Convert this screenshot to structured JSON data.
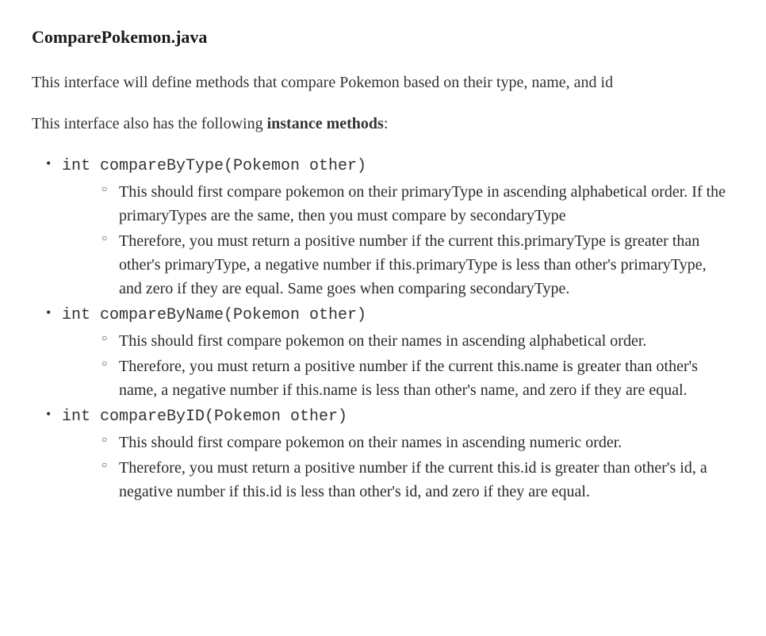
{
  "heading": "ComparePokemon.java",
  "intro": "This interface will define methods that compare Pokemon based on their type, name, and id",
  "secondPara_prefix": "This interface also has the following ",
  "secondPara_bold": "instance methods",
  "secondPara_suffix": ":",
  "methods": [
    {
      "signature": "int compareByType(Pokemon other)",
      "bullets": [
        "This should first compare pokemon on their primaryType in ascending alphabetical order. If the primaryTypes are the same, then you must compare by secondaryType",
        "Therefore, you must return a positive number if the current this.primaryType is greater than other's primaryType, a negative number if this.primaryType is less than other's primaryType, and zero if they are equal. Same goes when comparing secondaryType."
      ]
    },
    {
      "signature": "int compareByName(Pokemon other)",
      "bullets": [
        "This should first compare pokemon on their names in ascending alphabetical order.",
        "Therefore, you must return a positive number if the current this.name is greater than other's name, a negative number if this.name is less than other's name, and zero if they are equal."
      ]
    },
    {
      "signature": "int compareByID(Pokemon other)",
      "bullets": [
        "This should first compare pokemon on their names in ascending numeric order.",
        "Therefore, you must return a positive number if the current this.id is greater than other's id, a negative number if this.id is less than other's id, and zero if they are equal."
      ]
    }
  ]
}
